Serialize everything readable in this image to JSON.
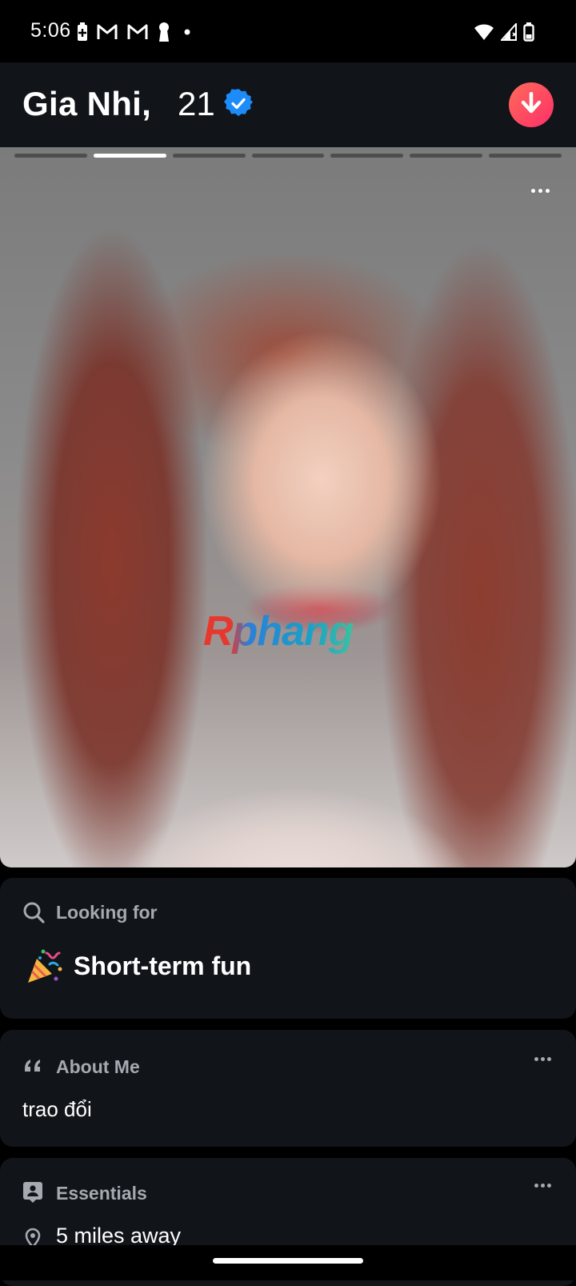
{
  "status_bar": {
    "time": "5:06",
    "left_icons": [
      "battery-saver-icon",
      "gmail-icon",
      "gmail-icon",
      "keyhole-icon",
      "dot-icon"
    ],
    "right_icons": [
      "wifi-icon",
      "signal-icon",
      "battery-icon"
    ]
  },
  "profile": {
    "name": "Gia Nhi,",
    "age": "21",
    "verified": true,
    "verified_color": "#1d8cf8",
    "collapse_button_color": "#fd3f5f"
  },
  "photo": {
    "total_photos": 7,
    "active_index": 1,
    "watermark": "Rphang"
  },
  "looking_for": {
    "label": "Looking for",
    "icon": "search-icon",
    "emoji_icon": "party-popper-icon",
    "value": "Short-term fun"
  },
  "about_me": {
    "label": "About Me",
    "icon": "quote-icon",
    "text": "trao đổi"
  },
  "essentials": {
    "label": "Essentials",
    "icon": "id-card-icon",
    "distance_icon": "location-pin-icon",
    "distance": "5 miles away"
  }
}
